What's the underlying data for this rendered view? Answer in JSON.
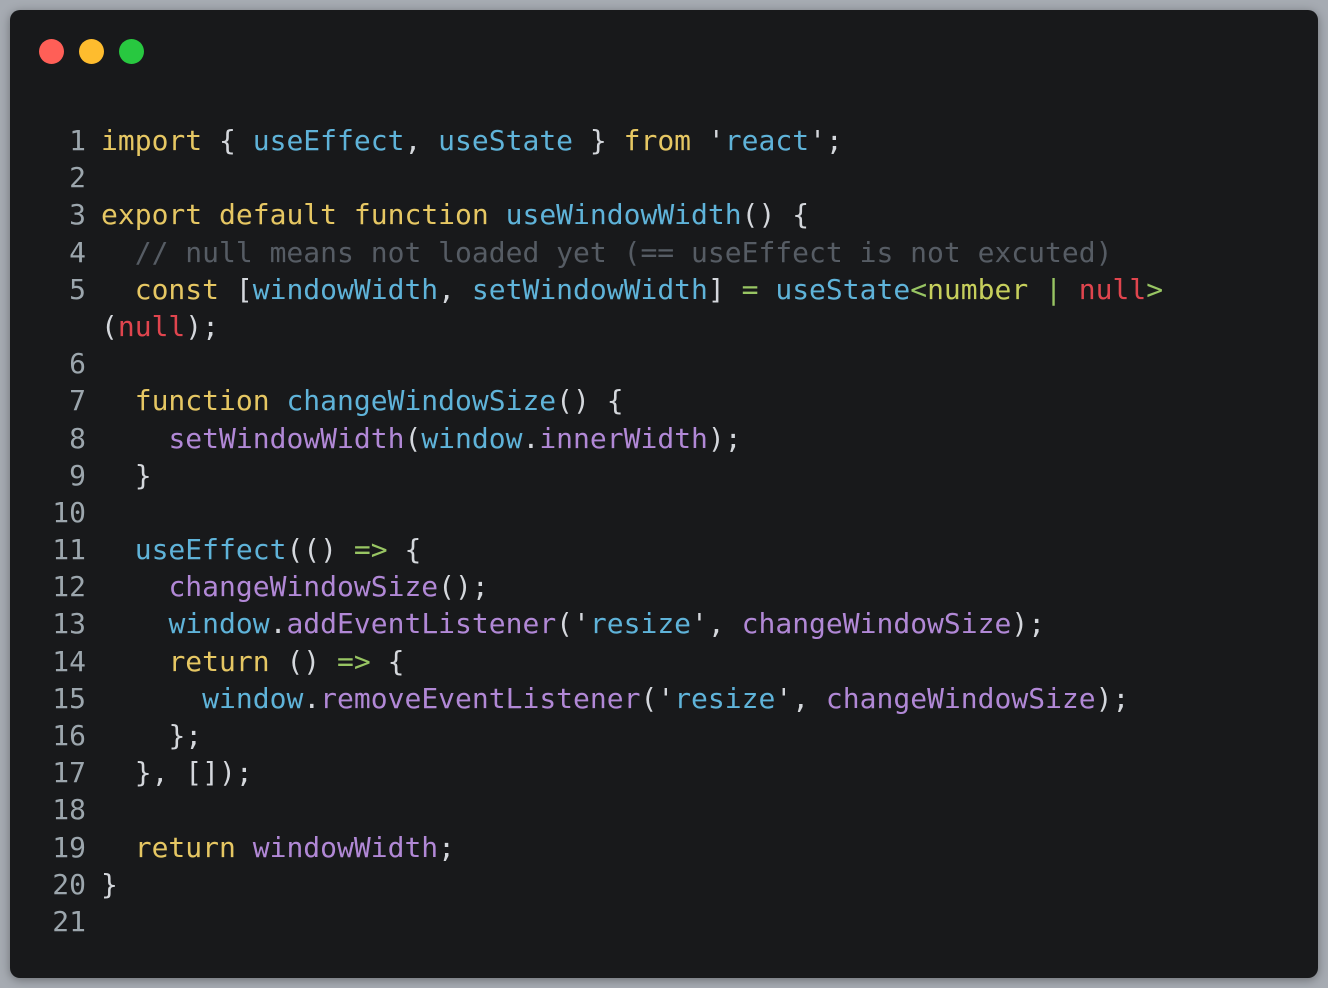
{
  "window": {
    "controls": [
      "close",
      "minimize",
      "maximize"
    ]
  },
  "code": {
    "lines": [
      {
        "n": "1",
        "tokens": [
          {
            "t": "import",
            "c": "kw"
          },
          {
            "t": " { ",
            "c": "pn"
          },
          {
            "t": "useEffect",
            "c": "fn"
          },
          {
            "t": ", ",
            "c": "pn"
          },
          {
            "t": "useState",
            "c": "fn"
          },
          {
            "t": " } ",
            "c": "pn"
          },
          {
            "t": "from",
            "c": "kw"
          },
          {
            "t": " ",
            "c": "pn"
          },
          {
            "t": "'",
            "c": "q"
          },
          {
            "t": "react",
            "c": "str"
          },
          {
            "t": "'",
            "c": "q"
          },
          {
            "t": ";",
            "c": "pn"
          }
        ]
      },
      {
        "n": "2",
        "tokens": []
      },
      {
        "n": "3",
        "tokens": [
          {
            "t": "export",
            "c": "kw"
          },
          {
            "t": " ",
            "c": "pn"
          },
          {
            "t": "default",
            "c": "kw"
          },
          {
            "t": " ",
            "c": "pn"
          },
          {
            "t": "function",
            "c": "kw"
          },
          {
            "t": " ",
            "c": "pn"
          },
          {
            "t": "useWindowWidth",
            "c": "fn"
          },
          {
            "t": "() {",
            "c": "pn"
          }
        ]
      },
      {
        "n": "4",
        "tokens": [
          {
            "t": "  // null means not loaded yet (== useEffect is not excuted)",
            "c": "cm"
          }
        ]
      },
      {
        "n": "5",
        "wrap": true,
        "tokens": [
          {
            "t": "  ",
            "c": "pn"
          },
          {
            "t": "const",
            "c": "kw"
          },
          {
            "t": " [",
            "c": "pn"
          },
          {
            "t": "windowWidth",
            "c": "fn"
          },
          {
            "t": ", ",
            "c": "pn"
          },
          {
            "t": "setWindowWidth",
            "c": "fn"
          },
          {
            "t": "] ",
            "c": "pn"
          },
          {
            "t": "=",
            "c": "op"
          },
          {
            "t": " ",
            "c": "pn"
          },
          {
            "t": "useState",
            "c": "fn"
          },
          {
            "t": "<",
            "c": "op"
          },
          {
            "t": "number",
            "c": "ty"
          },
          {
            "t": " | ",
            "c": "op"
          },
          {
            "t": "null",
            "c": "nl"
          },
          {
            "t": ">",
            "c": "op"
          },
          {
            "t": "\n(",
            "c": "pn"
          },
          {
            "t": "null",
            "c": "nl"
          },
          {
            "t": ");",
            "c": "pn"
          }
        ]
      },
      {
        "n": "6",
        "tokens": []
      },
      {
        "n": "7",
        "tokens": [
          {
            "t": "  ",
            "c": "pn"
          },
          {
            "t": "function",
            "c": "kw"
          },
          {
            "t": " ",
            "c": "pn"
          },
          {
            "t": "changeWindowSize",
            "c": "fn"
          },
          {
            "t": "() {",
            "c": "pn"
          }
        ]
      },
      {
        "n": "8",
        "tokens": [
          {
            "t": "    ",
            "c": "pn"
          },
          {
            "t": "setWindowWidth",
            "c": "fn2"
          },
          {
            "t": "(",
            "c": "pn"
          },
          {
            "t": "window",
            "c": "fn"
          },
          {
            "t": ".",
            "c": "pn"
          },
          {
            "t": "innerWidth",
            "c": "fn2"
          },
          {
            "t": ");",
            "c": "pn"
          }
        ]
      },
      {
        "n": "9",
        "tokens": [
          {
            "t": "  }",
            "c": "pn"
          }
        ]
      },
      {
        "n": "10",
        "tokens": []
      },
      {
        "n": "11",
        "tokens": [
          {
            "t": "  ",
            "c": "pn"
          },
          {
            "t": "useEffect",
            "c": "fn"
          },
          {
            "t": "(() ",
            "c": "pn"
          },
          {
            "t": "=>",
            "c": "op"
          },
          {
            "t": " {",
            "c": "pn"
          }
        ]
      },
      {
        "n": "12",
        "tokens": [
          {
            "t": "    ",
            "c": "pn"
          },
          {
            "t": "changeWindowSize",
            "c": "fn2"
          },
          {
            "t": "();",
            "c": "pn"
          }
        ]
      },
      {
        "n": "13",
        "tokens": [
          {
            "t": "    ",
            "c": "pn"
          },
          {
            "t": "window",
            "c": "fn"
          },
          {
            "t": ".",
            "c": "pn"
          },
          {
            "t": "addEventListener",
            "c": "fn2"
          },
          {
            "t": "(",
            "c": "pn"
          },
          {
            "t": "'",
            "c": "q"
          },
          {
            "t": "resize",
            "c": "str"
          },
          {
            "t": "'",
            "c": "q"
          },
          {
            "t": ", ",
            "c": "pn"
          },
          {
            "t": "changeWindowSize",
            "c": "fn2"
          },
          {
            "t": ");",
            "c": "pn"
          }
        ]
      },
      {
        "n": "14",
        "tokens": [
          {
            "t": "    ",
            "c": "pn"
          },
          {
            "t": "return",
            "c": "kw"
          },
          {
            "t": " () ",
            "c": "pn"
          },
          {
            "t": "=>",
            "c": "op"
          },
          {
            "t": " {",
            "c": "pn"
          }
        ]
      },
      {
        "n": "15",
        "tokens": [
          {
            "t": "      ",
            "c": "pn"
          },
          {
            "t": "window",
            "c": "fn"
          },
          {
            "t": ".",
            "c": "pn"
          },
          {
            "t": "removeEventListener",
            "c": "fn2"
          },
          {
            "t": "(",
            "c": "pn"
          },
          {
            "t": "'",
            "c": "q"
          },
          {
            "t": "resize",
            "c": "str"
          },
          {
            "t": "'",
            "c": "q"
          },
          {
            "t": ", ",
            "c": "pn"
          },
          {
            "t": "changeWindowSize",
            "c": "fn2"
          },
          {
            "t": ");",
            "c": "pn"
          }
        ]
      },
      {
        "n": "16",
        "tokens": [
          {
            "t": "    };",
            "c": "pn"
          }
        ]
      },
      {
        "n": "17",
        "tokens": [
          {
            "t": "  }, []);",
            "c": "pn"
          }
        ]
      },
      {
        "n": "18",
        "tokens": []
      },
      {
        "n": "19",
        "tokens": [
          {
            "t": "  ",
            "c": "pn"
          },
          {
            "t": "return",
            "c": "kw"
          },
          {
            "t": " ",
            "c": "pn"
          },
          {
            "t": "windowWidth",
            "c": "fn2"
          },
          {
            "t": ";",
            "c": "pn"
          }
        ]
      },
      {
        "n": "20",
        "tokens": [
          {
            "t": "}",
            "c": "pn"
          }
        ]
      },
      {
        "n": "21",
        "tokens": []
      }
    ]
  },
  "colors": {
    "background": "#18191b",
    "keyword": "#e6c763",
    "function": "#5fb3d9",
    "member": "#b188d6",
    "comment": "#565c64",
    "operator": "#98c563",
    "type": "#c6cf5c",
    "null": "#e0454e",
    "line_number": "#9ca6ad",
    "close": "#ff5f57",
    "minimize": "#febc2e",
    "maximize": "#28c840"
  }
}
